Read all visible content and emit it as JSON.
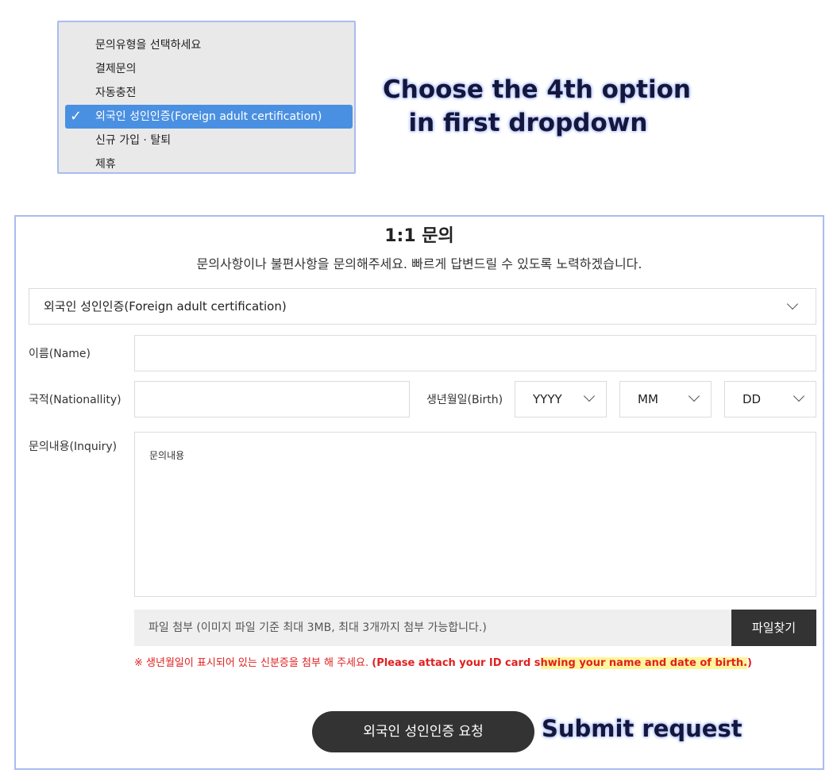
{
  "dropdown_popup": {
    "items": [
      {
        "label": "문의유형을 선택하세요"
      },
      {
        "label": "결제문의"
      },
      {
        "label": "자동충전"
      },
      {
        "label": "외국인 성인인증(Foreign adult certification)",
        "selected": true
      },
      {
        "label": "신규 가입 · 탈퇴"
      },
      {
        "label": "제휴"
      }
    ],
    "check_glyph": "✓",
    "highlight_color": "#4a90e2"
  },
  "annotations": {
    "step1_line1": "Choose the 4th option",
    "step1_line2": "in first dropdown",
    "step2": "Submit request"
  },
  "form": {
    "title": "1:1 문의",
    "subtitle": "문의사항이나 불편사항을 문의해주세요. 빠르게 답변드릴 수 있도록 노력하겠습니다.",
    "inquiry_type_value": "외국인 성인인증(Foreign adult certification)",
    "name_label": "이름(Name)",
    "name_value": "",
    "nationality_label": "국적(Nationallity)",
    "nationality_value": "",
    "birth_label": "생년월일(Birth)",
    "birth_year": "YYYY",
    "birth_month": "MM",
    "birth_day": "DD",
    "inquiry_label": "문의내용(Inquiry)",
    "inquiry_placeholder": "문의내용",
    "file_placeholder": "파일 첨부 (이미지 파일 기준 최대 3MB, 최대 3개까지 첨부 가능합니다.)",
    "file_button": "파일찾기",
    "notice_prefix": "※ 생년월일이 표시되어 있는 신분증을 첨부 해 주세요. ",
    "notice_bold": "(Please attach your ID card s",
    "notice_highlight": "hwing your name and date of birth.",
    "notice_suffix": ")",
    "submit_label": "외국인 성인인증 요청"
  },
  "colors": {
    "accent_border": "#a9bcf0",
    "button_dark": "#333333",
    "notice_red": "#e02020",
    "highlight_yellow": "#fff59a"
  }
}
